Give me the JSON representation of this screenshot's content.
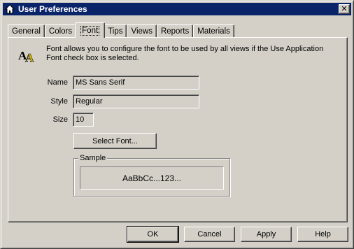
{
  "window": {
    "title": "User Preferences",
    "title_icon": "house-gear-icon",
    "close_glyph": "✕",
    "titlebar_color": "#0a246a"
  },
  "tabs": [
    {
      "label": "General",
      "active": false
    },
    {
      "label": "Colors",
      "active": false
    },
    {
      "label": "Font",
      "active": true
    },
    {
      "label": "Tips",
      "active": false
    },
    {
      "label": "Views",
      "active": false
    },
    {
      "label": "Reports",
      "active": false
    },
    {
      "label": "Materials",
      "active": false
    }
  ],
  "font_tab": {
    "info_icon": "font-aa-icon",
    "description": "Font allows you to configure the font to be used by all views if the Use Application Font check box is selected.",
    "name_label": "Name",
    "name_value": "MS Sans Serif",
    "style_label": "Style",
    "style_value": "Regular",
    "size_label": "Size",
    "size_value": "10",
    "select_font_button": "Select Font...",
    "sample_group_label": "Sample",
    "sample_text": "AaBbCc...123..."
  },
  "buttons": {
    "ok": "OK",
    "cancel": "Cancel",
    "apply": "Apply",
    "help": "Help"
  }
}
